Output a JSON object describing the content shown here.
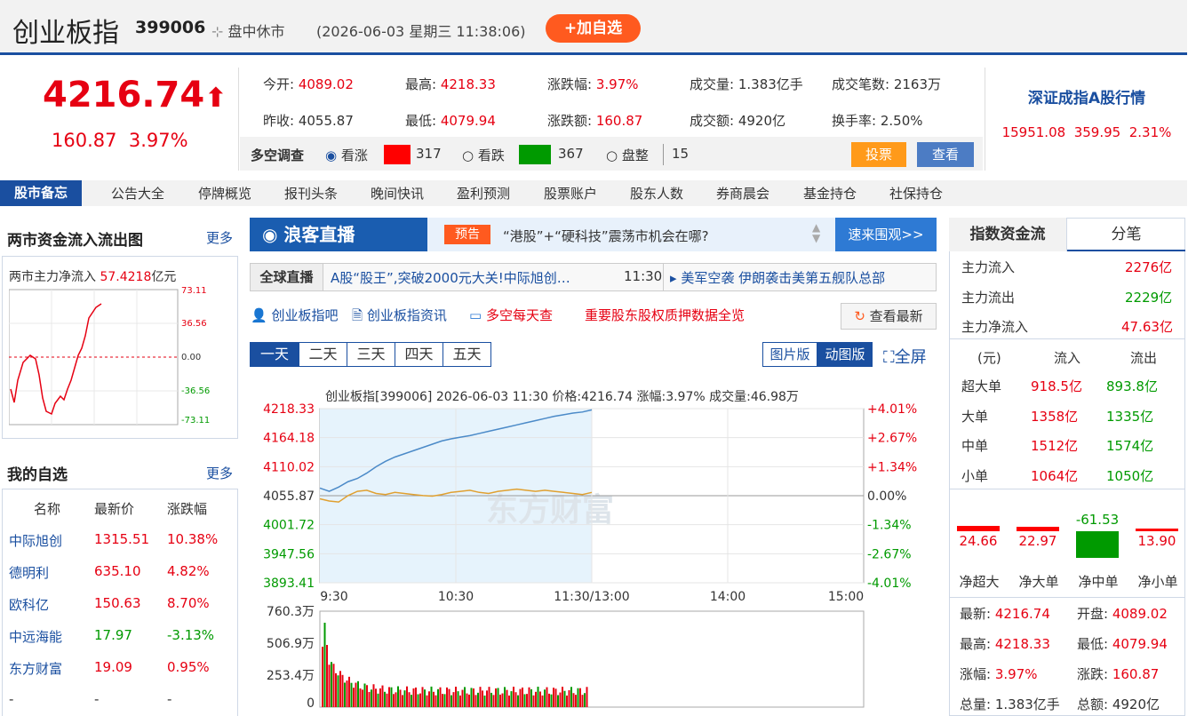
{
  "header": {
    "title": "创业板指",
    "code": "399006",
    "status": "盘中休市",
    "datetime": "(2026-06-03 星期三 11:38:06)",
    "add_btn": "+加自选"
  },
  "summary": {
    "price": "4216.74",
    "change": "160.87",
    "pct": "3.97%",
    "open_l": "今开:",
    "open": "4089.02",
    "high_l": "最高:",
    "high": "4218.33",
    "zdf_l": "涨跌幅:",
    "zdf": "3.97%",
    "vol_l": "成交量:",
    "vol": "1.383亿手",
    "deals_l": "成交笔数:",
    "deals": "2163万",
    "prev_l": "昨收:",
    "prev": "4055.87",
    "low_l": "最低:",
    "low": "4079.94",
    "zde_l": "涨跌额:",
    "zde": "160.87",
    "amt_l": "成交额:",
    "amt": "4920亿",
    "turn_l": "换手率:",
    "turn": "2.50%"
  },
  "poll": {
    "label": "多空调查",
    "bull": "看涨",
    "bull_n": "317",
    "bear": "看跌",
    "bear_n": "367",
    "flat": "盘整",
    "flat_n": "15",
    "vote": "投票",
    "view": "查看"
  },
  "sz": {
    "title": "深证成指A股行情",
    "price": "15951.08",
    "chg": "359.95",
    "pct": "2.31%"
  },
  "nav": {
    "label": "股市备忘",
    "items": [
      "公告大全",
      "停牌概览",
      "报刊头条",
      "晚间快讯",
      "盈利预测",
      "股票账户",
      "股东人数",
      "券商晨会",
      "基金持仓",
      "社保持仓"
    ]
  },
  "flow": {
    "title": "两市资金流入流出图",
    "more": "更多",
    "line_label": "两市主力净流入",
    "line_val": "57.4218",
    "line_unit": "亿元",
    "ticks": [
      "73.11",
      "36.56",
      "0.00",
      "-36.56",
      "-73.11"
    ]
  },
  "watch": {
    "title": "我的自选",
    "more": "更多",
    "headers": [
      "名称",
      "最新价",
      "涨跌幅"
    ],
    "rows": [
      {
        "name": "中际旭创",
        "price": "1315.51",
        "pct": "10.38%"
      },
      {
        "name": "德明利",
        "price": "635.10",
        "pct": "4.82%"
      },
      {
        "name": "欧科亿",
        "price": "150.63",
        "pct": "8.70%"
      },
      {
        "name": "中远海能",
        "price": "17.97",
        "pct": "-3.13%"
      },
      {
        "name": "东方财富",
        "price": "19.09",
        "pct": "0.95%"
      },
      {
        "name": "-",
        "price": "-",
        "pct": "-"
      }
    ]
  },
  "live": {
    "logo": "浪客直播",
    "tag": "预告",
    "text": "“港股”+“硬科技”震荡市机会在哪?",
    "btn": "速来围观>>"
  },
  "ticker": {
    "label": "全球直播",
    "text": "A股“股王”,突破2000元大关!中际旭创…",
    "time": "11:30",
    "text2": "美军空袭 伊朗袭击美第五舰队总部"
  },
  "links": {
    "l1": "创业板指吧",
    "l2": "创业板指资讯",
    "l3": "多空每天查",
    "l4": "重要股东股权质押数据全览",
    "refresh": "查看最新"
  },
  "chart_tabs": {
    "tabs": [
      "一天",
      "二天",
      "三天",
      "四天",
      "五天"
    ],
    "img": "图片版",
    "anim": "动图版",
    "full": "全屏"
  },
  "chart_data": {
    "type": "line",
    "header": "创业板指[399006] 2026-06-03 11:30 价格:4216.74 涨幅:3.97% 成交量:46.98万",
    "y_left": [
      "4218.33",
      "4164.18",
      "4110.02",
      "4055.87",
      "4001.72",
      "3947.56",
      "3893.41"
    ],
    "y_right": [
      "+4.01%",
      "+2.67%",
      "+1.34%",
      "0.00%",
      "-1.34%",
      "-2.67%",
      "-4.01%"
    ],
    "x": [
      "9:30",
      "10:30",
      "11:30/13:00",
      "14:00",
      "15:00"
    ],
    "vol_ticks": [
      "760.3万",
      "506.9万",
      "253.4万",
      "0"
    ],
    "watermark": "东方财富",
    "series": [
      {
        "values": [
          4070,
          4064,
          4072,
          4082,
          4088,
          4098,
          4110,
          4120,
          4128,
          4134,
          4140,
          4146,
          4152,
          4158,
          4162,
          4165,
          4168,
          4172,
          4176,
          4180,
          4184,
          4188,
          4192,
          4196,
          4200,
          4204,
          4207,
          4210,
          4212,
          4216
        ]
      },
      {
        "values": [
          4050,
          4046,
          4044,
          4056,
          4064,
          4066,
          4060,
          4058,
          4062,
          4060,
          4058,
          4056,
          4055,
          4058,
          4062,
          4064,
          4066,
          4062,
          4060,
          4064,
          4066,
          4068,
          4066,
          4064,
          4066,
          4064,
          4062,
          4060,
          4058,
          4062
        ]
      }
    ]
  },
  "fund": {
    "tab1": "指数资金流",
    "tab2": "分笔",
    "in_l": "主力流入",
    "in": "2276亿",
    "out_l": "主力流出",
    "out": "2229亿",
    "net_l": "主力净流入",
    "net": "47.63亿",
    "headers": [
      "(元)",
      "流入",
      "流出"
    ],
    "rows": [
      [
        "超大单",
        "918.5亿",
        "893.8亿"
      ],
      [
        "大单",
        "1358亿",
        "1335亿"
      ],
      [
        "中单",
        "1512亿",
        "1574亿"
      ],
      [
        "小单",
        "1064亿",
        "1050亿"
      ]
    ],
    "bars": [
      {
        "label": "净超大",
        "val": "24.66",
        "v": 24.66
      },
      {
        "label": "净大单",
        "val": "22.97",
        "v": 22.97
      },
      {
        "label": "净中单",
        "val": "-61.53",
        "v": -61.53
      },
      {
        "label": "净小单",
        "val": "13.90",
        "v": 13.9
      }
    ]
  },
  "bottom": {
    "new_l": "最新:",
    "new": "4216.74",
    "open_l": "开盘:",
    "open": "4089.02",
    "high_l": "最高:",
    "high": "4218.33",
    "low_l": "最低:",
    "low": "4079.94",
    "zf_l": "涨幅:",
    "zf": "3.97%",
    "zd_l": "涨跌:",
    "zd": "160.87",
    "vol_l": "总量:",
    "vol": "1.383亿手",
    "amt_l": "总额:",
    "amt": "4920亿"
  },
  "colors": {
    "red": "#e60012",
    "green": "#009a00",
    "blue": "#1a4fa0",
    "orange": "#ff5a1f"
  }
}
